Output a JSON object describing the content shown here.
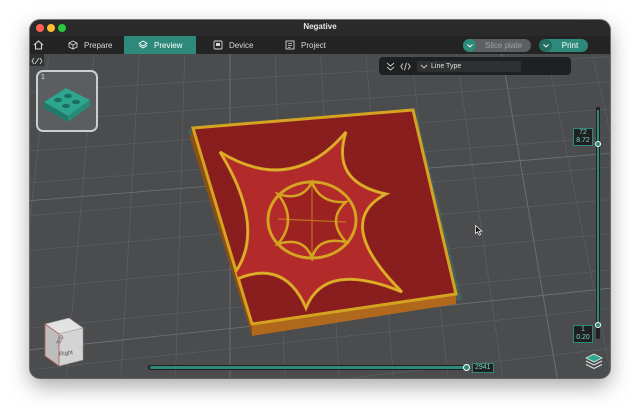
{
  "window": {
    "title": "Negative"
  },
  "tabs": [
    {
      "label": "Prepare",
      "icon": "cube-icon",
      "active": false
    },
    {
      "label": "Preview",
      "icon": "layers-icon",
      "active": true
    },
    {
      "label": "Device",
      "icon": "device-icon",
      "active": false
    },
    {
      "label": "Project",
      "icon": "project-icon",
      "active": false
    }
  ],
  "actions": {
    "slice_label": "Slice plate",
    "print_label": "Print"
  },
  "plate": {
    "number": "1"
  },
  "toolbar": {
    "view_type_label": "Line Type"
  },
  "layer_slider": {
    "top_layer": "72",
    "top_height": "8.72",
    "bottom_layer": "1",
    "bottom_height": "0.20"
  },
  "move_slider": {
    "value": "2941"
  },
  "view_cube": {
    "top_label": "Top",
    "right_label": "Right"
  },
  "colors": {
    "accent": "#2d8a7a",
    "wall": "#d4a420",
    "infill": "#9c2222",
    "base": "#b0681c",
    "grid_bg": "#4a4c4e"
  },
  "icons": [
    "home-icon",
    "collapse-icon",
    "expand-icon",
    "code-icon",
    "chevron-down-icon",
    "layers-stack-icon",
    "mouse-cursor-icon"
  ]
}
